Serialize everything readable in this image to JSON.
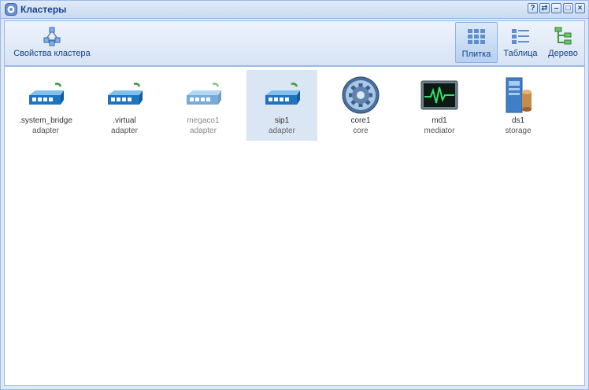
{
  "window": {
    "title": "Кластеры",
    "buttons": [
      "?",
      "⇄",
      "–",
      "□",
      "×"
    ]
  },
  "toolbar": {
    "cluster_properties": "Свойства кластера",
    "view_tiles": "Плитка",
    "view_table": "Таблица",
    "view_tree": "Дерево",
    "active_view": "Плитка"
  },
  "colors": {
    "title_text": "#15428b",
    "border": "#99bbe8",
    "selection": "#dbe6f4"
  },
  "clusters": [
    {
      "name": ".system_bridge",
      "type": "adapter",
      "icon": "adapter-icon"
    },
    {
      "name": ".virtual",
      "type": "adapter",
      "icon": "adapter-icon"
    },
    {
      "name": "megaco1",
      "type": "adapter",
      "icon": "adapter-icon"
    },
    {
      "name": "sip1",
      "type": "adapter",
      "icon": "adapter-icon"
    },
    {
      "name": "core1",
      "type": "core",
      "icon": "gear-icon"
    },
    {
      "name": "md1",
      "type": "mediator",
      "icon": "monitor-icon"
    },
    {
      "name": "ds1",
      "type": "storage",
      "icon": "storage-icon"
    }
  ]
}
